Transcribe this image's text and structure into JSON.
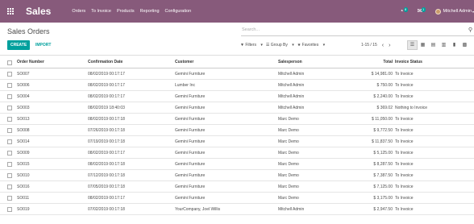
{
  "navbar": {
    "brand": "Sales",
    "menu": [
      "Orders",
      "To Invoice",
      "Products",
      "Reporting",
      "Configuration"
    ],
    "activity_count": "8",
    "message_count": "1",
    "user": "Mitchell Admin"
  },
  "control": {
    "title": "Sales Orders",
    "search_placeholder": "Search...",
    "create_label": "CREATE",
    "import_label": "IMPORT",
    "filters_label": "Filters",
    "groupby_label": "Group By",
    "favorites_label": "Favorites",
    "pager": "1-15 / 15"
  },
  "table": {
    "headers": {
      "number": "Order Number",
      "date": "Confirmation Date",
      "customer": "Customer",
      "salesperson": "Salesperson",
      "total": "Total",
      "invoice": "Invoice Status"
    },
    "rows": [
      {
        "number": "SO007",
        "date": "08/02/2019 00:17:17",
        "customer": "Gemini Furniture",
        "salesperson": "Mitchell Admin",
        "total": "$ 14,981.00",
        "invoice": "To Invoice"
      },
      {
        "number": "SO006",
        "date": "08/02/2019 00:17:17",
        "customer": "Lumber Inc",
        "salesperson": "Mitchell Admin",
        "total": "$ 750.00",
        "invoice": "To Invoice"
      },
      {
        "number": "SO004",
        "date": "08/02/2019 00:17:17",
        "customer": "Gemini Furniture",
        "salesperson": "Mitchell Admin",
        "total": "$ 2,240.00",
        "invoice": "To Invoice"
      },
      {
        "number": "SO003",
        "date": "08/02/2019 18:40:03",
        "customer": "Gemini Furniture",
        "salesperson": "Mitchell Admin",
        "total": "$ 369.02",
        "invoice": "Nothing to Invoice"
      },
      {
        "number": "SO013",
        "date": "08/02/2019 00:17:18",
        "customer": "Gemini Furniture",
        "salesperson": "Marc Demo",
        "total": "$ 11,050.00",
        "invoice": "To Invoice"
      },
      {
        "number": "SO008",
        "date": "07/26/2019 00:17:18",
        "customer": "Gemini Furniture",
        "salesperson": "Marc Demo",
        "total": "$ 9,772.50",
        "invoice": "To Invoice"
      },
      {
        "number": "SO014",
        "date": "07/19/2019 00:17:18",
        "customer": "Gemini Furniture",
        "salesperson": "Marc Demo",
        "total": "$ 11,837.50",
        "invoice": "To Invoice"
      },
      {
        "number": "SO009",
        "date": "08/02/2019 00:17:17",
        "customer": "Gemini Furniture",
        "salesperson": "Marc Demo",
        "total": "$ 5,125.00",
        "invoice": "To Invoice"
      },
      {
        "number": "SO015",
        "date": "08/02/2019 00:17:18",
        "customer": "Gemini Furniture",
        "salesperson": "Marc Demo",
        "total": "$ 8,287.50",
        "invoice": "To Invoice"
      },
      {
        "number": "SO010",
        "date": "07/12/2019 00:17:18",
        "customer": "Gemini Furniture",
        "salesperson": "Marc Demo",
        "total": "$ 7,387.50",
        "invoice": "To Invoice"
      },
      {
        "number": "SO016",
        "date": "07/05/2019 00:17:18",
        "customer": "Gemini Furniture",
        "salesperson": "Marc Demo",
        "total": "$ 7,125.00",
        "invoice": "To Invoice"
      },
      {
        "number": "SO011",
        "date": "08/02/2019 00:17:17",
        "customer": "Gemini Furniture",
        "salesperson": "Marc Demo",
        "total": "$ 3,175.00",
        "invoice": "To Invoice"
      },
      {
        "number": "SO019",
        "date": "07/02/2019 00:17:18",
        "customer": "YourCompany, Joel Willis",
        "salesperson": "Mitchell Admin",
        "total": "$ 2,947.50",
        "invoice": "To Invoice"
      }
    ]
  },
  "colors": {
    "navbar": "#875a7b",
    "accent": "#00a09d"
  },
  "icons": [
    "apps-icon",
    "activity-icon",
    "messages-icon",
    "search-icon",
    "list-view-icon",
    "kanban-view-icon",
    "calendar-view-icon",
    "pivot-view-icon",
    "graph-view-icon",
    "activity-view-icon"
  ]
}
